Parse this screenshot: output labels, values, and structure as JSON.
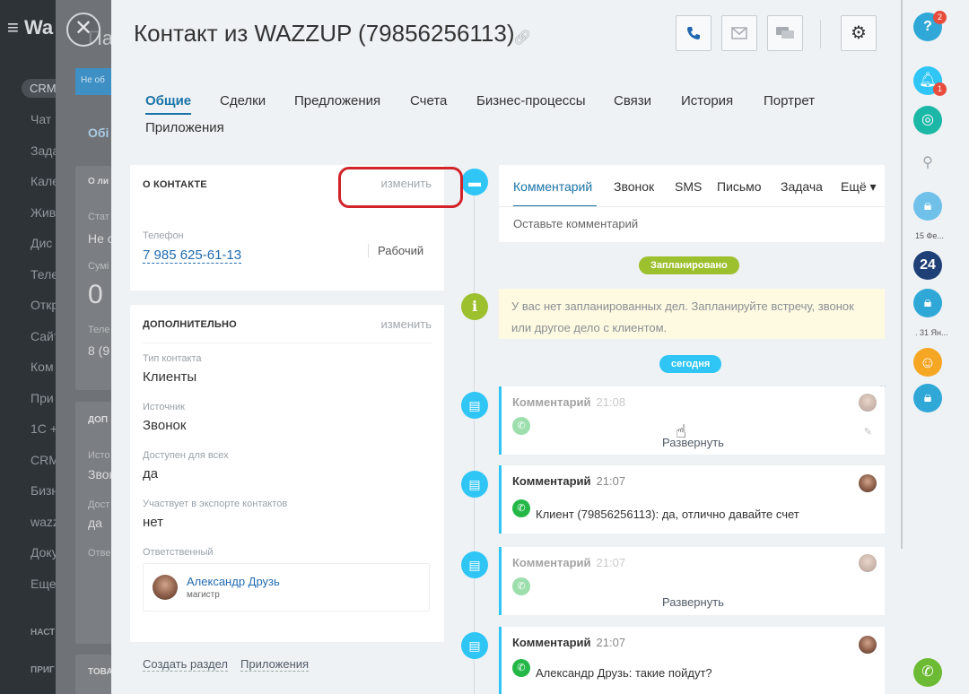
{
  "background": {
    "brand": "Wa",
    "crm_badge": "CRM",
    "menu": [
      "Чат",
      "Зада",
      "Кале",
      "Жив",
      "Дис",
      "Теле",
      "Откр",
      "Сайт",
      "Ком",
      "При",
      "1С +",
      "CRM",
      "Бизн",
      "wazz",
      "Доку",
      "Еще"
    ],
    "section_1": "НАСТ",
    "section_2": "ПРИГ",
    "mid_tab_label": "Не об",
    "mid_tab2_label": "Обі",
    "mid_texts": [
      "Пар",
      "О ли",
      "Стат",
      "Не с",
      "Сумі",
      "0",
      "Теле",
      "8 (9",
      "ДОП",
      "Исто",
      "Звон",
      "Дост",
      "да",
      "Отве",
      "ТОВА"
    ]
  },
  "header": {
    "title": "Контакт из WAZZUP (79856256113)",
    "icons": [
      "phone-icon",
      "mail-icon",
      "chat-icon",
      "gear-icon"
    ]
  },
  "tabs": [
    "Общие",
    "Сделки",
    "Предложения",
    "Счета",
    "Бизнес-процессы",
    "Связи",
    "История",
    "Портрет",
    "Приложения"
  ],
  "about": {
    "heading": "О КОНТАКТЕ",
    "edit": "изменить",
    "phone_label": "Телефон",
    "phone_value": "7 985 625-61-13",
    "phone_type": "Рабочий"
  },
  "extra": {
    "heading": "ДОПОЛНИТЕЛЬНО",
    "edit": "изменить",
    "fields": [
      {
        "label": "Тип контакта",
        "value": "Клиенты"
      },
      {
        "label": "Источник",
        "value": "Звонок"
      },
      {
        "label": "Доступен для всех",
        "value": "да"
      },
      {
        "label": "Участвует в экспорте контактов",
        "value": "нет"
      }
    ],
    "responsible_label": "Ответственный",
    "responsible_name": "Александр Друзь",
    "responsible_role": "магистр"
  },
  "footer_links": [
    "Создать раздел",
    "Приложения"
  ],
  "composer": {
    "tabs": [
      "Комментарий",
      "Звонок",
      "SMS",
      "Письмо",
      "Задача",
      "Ещё ▾"
    ],
    "placeholder": "Оставьте комментарий"
  },
  "timeline": {
    "planned": "Запланировано",
    "notice_line1": "У вас нет запланированных дел. Запланируйте встречу, звонок",
    "notice_line2": "или другое дело с клиентом.",
    "today": "сегодня",
    "entries": [
      {
        "title": "Комментарий",
        "time": "21:08",
        "text": "",
        "expand": "Развернуть"
      },
      {
        "title": "Комментарий",
        "time": "21:07",
        "text": "Клиент (79856256113): да, отлично давайте счет",
        "expand": ""
      },
      {
        "title": "Комментарий",
        "time": "21:07",
        "text": "",
        "expand": "Развернуть"
      },
      {
        "title": "Комментарий",
        "time": "21:07",
        "text": "Александр Друзь: такие пойдут?",
        "expand": ""
      }
    ]
  },
  "right_bar": {
    "help_badge": "2",
    "bell_badge": "1",
    "date1": "15 Фе...",
    "b24": "24",
    "date2": ". 31 Ян..."
  },
  "colors": {
    "accent": "#1a73a8",
    "timeline_dot": "#2fc6f6",
    "planned_pill": "#9dc02f",
    "today_pill": "#2fc6f6",
    "annotation": "#d12329",
    "whatsapp": "#25b848"
  }
}
